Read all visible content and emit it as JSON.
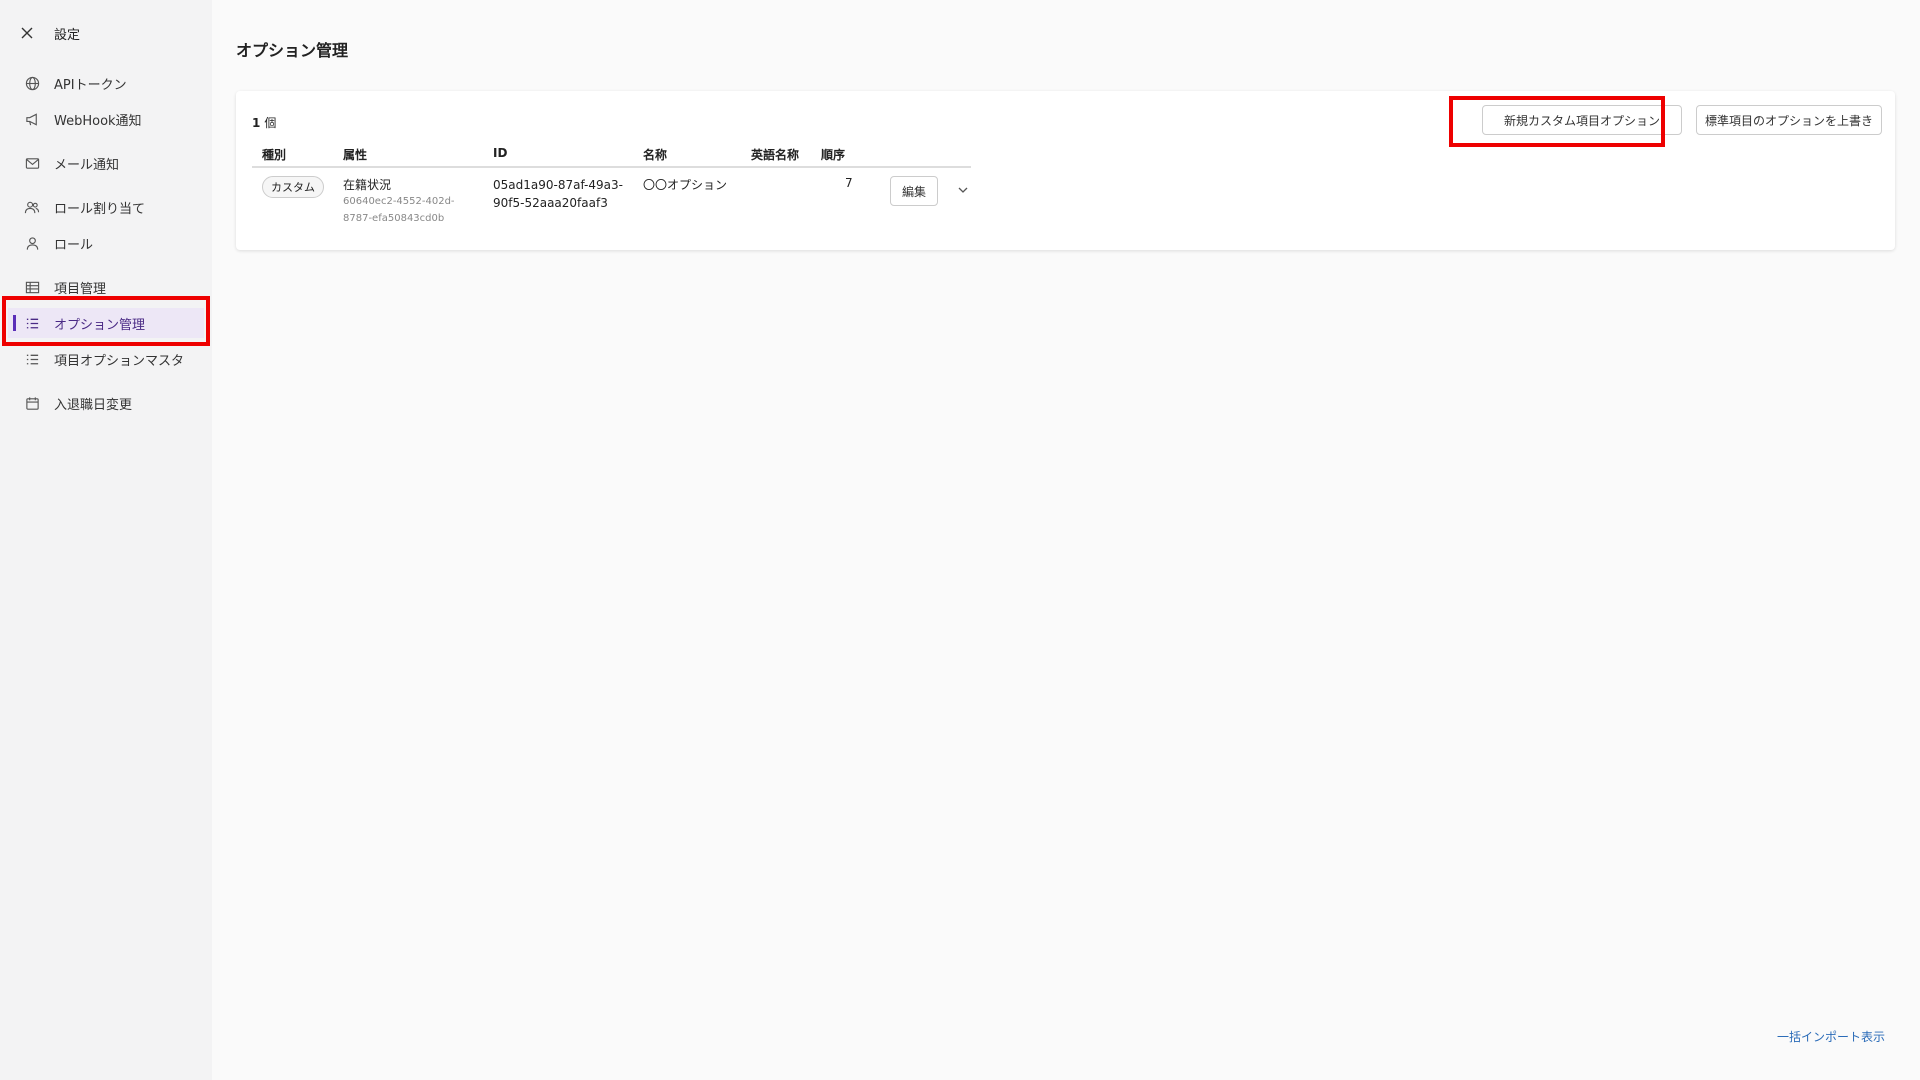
{
  "sidebar": {
    "title": "設定",
    "items": [
      {
        "label": "APIトークン",
        "icon": "globe-icon"
      },
      {
        "label": "WebHook通知",
        "icon": "megaphone-icon"
      },
      {
        "label": "メール通知",
        "icon": "mail-icon"
      },
      {
        "label": "ロール割り当て",
        "icon": "users-icon"
      },
      {
        "label": "ロール",
        "icon": "user-icon"
      },
      {
        "label": "項目管理",
        "icon": "table-icon"
      },
      {
        "label": "オプション管理",
        "icon": "list-icon",
        "active": true
      },
      {
        "label": "項目オプションマスタ",
        "icon": "list-icon"
      },
      {
        "label": "入退職日変更",
        "icon": "calendar-icon"
      }
    ]
  },
  "main": {
    "title": "オプション管理",
    "count": "1",
    "count_unit": "個",
    "buttons": {
      "new_custom": "新規カスタム項目オプション",
      "override_standard": "標準項目のオプションを上書き"
    },
    "table": {
      "headers": [
        "種別",
        "属性",
        "ID",
        "名称",
        "英語名称",
        "順序"
      ],
      "rows": [
        {
          "type": "カスタム",
          "attr": "在籍状況",
          "attr_id_line1": "60640ec2-4552-402d-",
          "attr_id_line2": "8787-efa50843cd0b",
          "id_line1": "05ad1a90-87af-49a3-",
          "id_line2": "90f5-52aaa20faaf3",
          "name": "〇〇オプション",
          "english_name": "",
          "order": "7",
          "edit_label": "編集"
        }
      ]
    },
    "bulk_import_link": "一括インポート表示"
  },
  "colors": {
    "highlight": "#ee0000",
    "active_bg": "#ede7f6",
    "link": "#2a6bb8"
  }
}
